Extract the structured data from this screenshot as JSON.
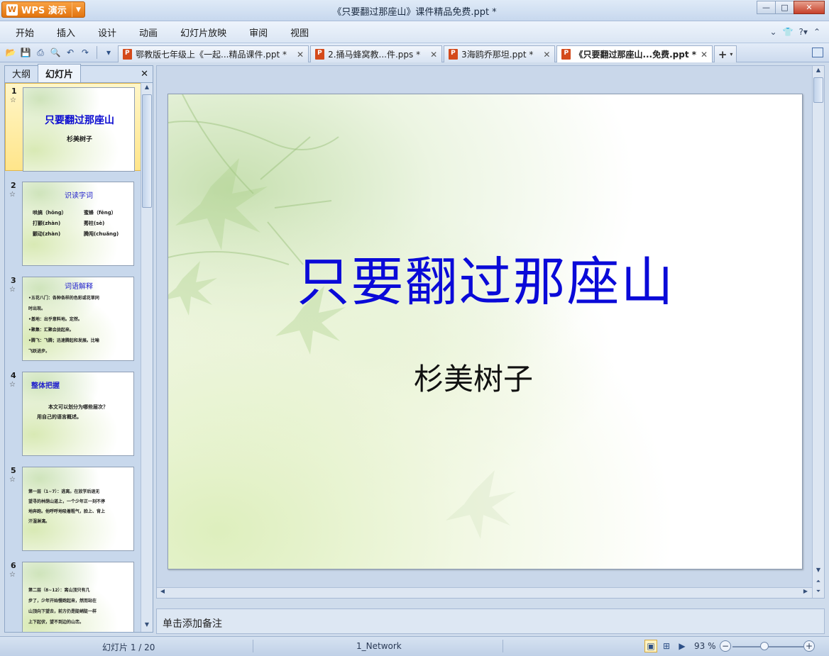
{
  "app": {
    "button_label": "WPS 演示",
    "window_title": "《只要翻过那座山》课件精品免费.ppt *"
  },
  "window_controls": [
    "minimize-icon",
    "maximize-icon",
    "close-icon"
  ],
  "menu": [
    "开始",
    "插入",
    "设计",
    "动画",
    "幻灯片放映",
    "审阅",
    "视图"
  ],
  "quick_access_icons": [
    "open-icon",
    "save-icon",
    "print-icon",
    "print-preview-icon",
    "undo-icon",
    "redo-icon",
    "customize-icon"
  ],
  "tabs": [
    {
      "label": "鄂教版七年级上《一起...精品课件.ppt *",
      "active": false
    },
    {
      "label": "2.捅马蜂窝教...件.pps *",
      "active": false
    },
    {
      "label": "3海鸥乔那坦.ppt *",
      "active": false
    },
    {
      "label": "《只要翻过那座山...免费.ppt *",
      "active": true
    }
  ],
  "left_pane": {
    "tabs": [
      "大纲",
      "幻灯片"
    ],
    "active_tab": "幻灯片"
  },
  "thumbnails": {
    "s1": {
      "title": "只要翻过那座山",
      "subtitle": "杉美树子"
    },
    "s2": {
      "heading": "识读字词",
      "l1": "哄搞（hōng）",
      "r1": "蜜蜂（fēng）",
      "l2": "打颤(zhàn)",
      "r2": "莠柱(sè)",
      "l3": "颤动(zhàn)",
      "r3": "腾闯(chuǎng)"
    },
    "s3": {
      "heading": "词语解释",
      "lines": [
        "•五花八门：各种各样的色彩或花草同",
        "时出现。",
        "•基地：出乎意料地。定然。",
        "•聚集：汇聚会拢起来。",
        "•腾飞：飞腾；迅速腾起和发展。比喻",
        "飞跃进步。"
      ]
    },
    "s4": {
      "heading": "整体把握",
      "q1": "本文可以划分为哪些层次？",
      "q2": "用自己的语言概述。"
    },
    "s5": {
      "lines": [
        "第一层（1~7）：逃离。在放学后退无",
        "望寻的林荫山道上，一个少年正一刻不停",
        "地奔跑。他呼呼地吸着粗气，脸上、背上",
        "汗湿淋漓。"
      ]
    },
    "s6": {
      "lines": [
        "第二层（8~12）：离山顶只有几",
        "步了，少年开始慢跑起来，然而站在",
        "山顶向下望去，前方仍是陡峭陡一样",
        "上下起伏，望不到边的山峦。"
      ]
    }
  },
  "slide": {
    "title": "只要翻过那座山",
    "subtitle": "杉美树子",
    "title_color": "#0a0ad8"
  },
  "notes_placeholder": "单击添加备注",
  "status": {
    "slide_counter": "幻灯片 1 / 20",
    "theme": "1_Network",
    "zoom": "93 %"
  },
  "accent_orange": "#e2740f"
}
